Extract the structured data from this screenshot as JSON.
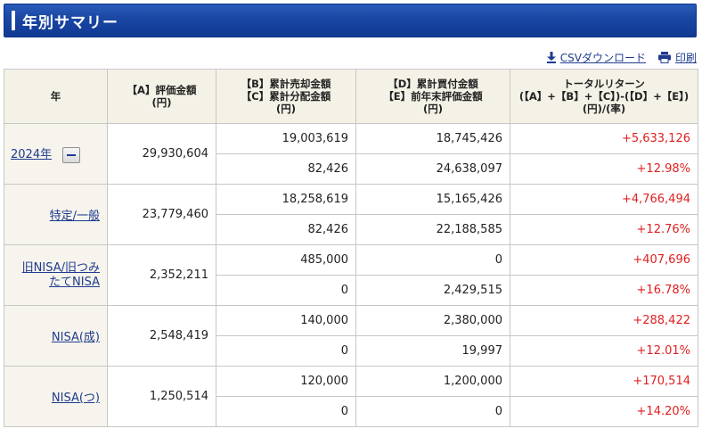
{
  "header": {
    "title": "年別サマリー"
  },
  "toolbar": {
    "csv_label": "CSVダウンロード",
    "print_label": "印刷"
  },
  "columns": {
    "year": "年",
    "a_line1": "【A】評価金額",
    "a_line2": "(円)",
    "bc_line1": "【B】累計売却金額",
    "bc_line2": "【C】累計分配金額",
    "bc_line3": "(円)",
    "de_line1": "【D】累計買付金額",
    "de_line2": "【E】前年末評価金額",
    "de_line3": "(円)",
    "tr_line1": "トータルリターン",
    "tr_line2": "(【A】+【B】+【C】)-(【D】+【E】)",
    "tr_line3": "(円)/(率)"
  },
  "rows": [
    {
      "label": "2024年",
      "valuation": "29,930,604",
      "sale": "19,003,619",
      "purchase": "18,745,426",
      "return_yen": "+5,633,126",
      "distribution": "82,426",
      "prev_valuation": "24,638,097",
      "return_rate": "+12.98%"
    },
    {
      "label": "特定/一般",
      "valuation": "23,779,460",
      "sale": "18,258,619",
      "purchase": "15,165,426",
      "return_yen": "+4,766,494",
      "distribution": "82,426",
      "prev_valuation": "22,188,585",
      "return_rate": "+12.76%"
    },
    {
      "label_line1": "旧NISA/旧つみ",
      "label_line2": "たてNISA",
      "valuation": "2,352,211",
      "sale": "485,000",
      "purchase": "0",
      "return_yen": "+407,696",
      "distribution": "0",
      "prev_valuation": "2,429,515",
      "return_rate": "+16.78%"
    },
    {
      "label": "NISA(成)",
      "valuation": "2,548,419",
      "sale": "140,000",
      "purchase": "2,380,000",
      "return_yen": "+288,422",
      "distribution": "0",
      "prev_valuation": "19,997",
      "return_rate": "+12.01%"
    },
    {
      "label": "NISA(つ)",
      "valuation": "1,250,514",
      "sale": "120,000",
      "purchase": "1,200,000",
      "return_yen": "+170,514",
      "distribution": "0",
      "prev_valuation": "0",
      "return_rate": "+14.20%"
    }
  ],
  "colors": {
    "header_bg": "#1a46a3",
    "link": "#1f3b8f",
    "positive": "#e02020",
    "header_cell_bg": "#f4f1e6"
  },
  "icons": {
    "csv": "download-icon",
    "print": "printer-icon",
    "collapse": "minus-icon"
  }
}
